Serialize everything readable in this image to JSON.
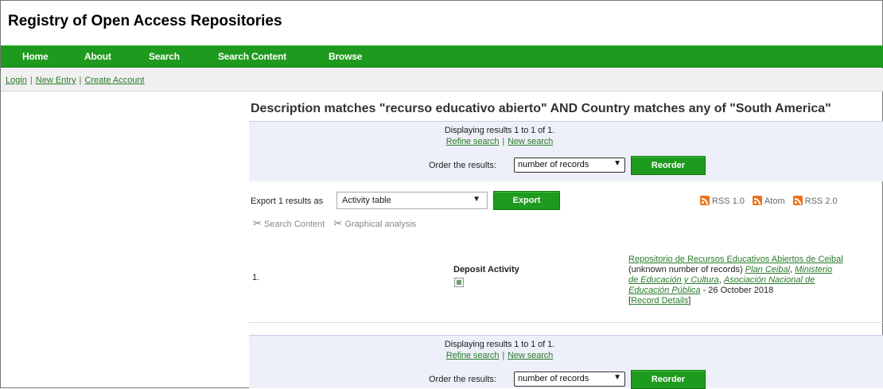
{
  "site": {
    "title": "Registry of Open Access Repositories"
  },
  "nav": {
    "items": [
      {
        "label": "Home"
      },
      {
        "label": "About"
      },
      {
        "label": "Search"
      },
      {
        "label": "Search Content"
      },
      {
        "label": "Browse"
      }
    ]
  },
  "userbar": {
    "login": "Login",
    "new_entry": "New Entry",
    "create_account": "Create Account",
    "separator": "|"
  },
  "results": {
    "heading": "Description matches \"recurso educativo abierto\" AND Country matches any of \"South America\"",
    "displaying_top": "Displaying results 1 to 1 of 1.",
    "displaying_bottom": "Displaying results 1 to 1 of 1.",
    "refine": "Refine search",
    "new_search": "New search",
    "link_separator": "|",
    "order_label": "Order the results:",
    "order_value": "number of records",
    "reorder_button": "Reorder"
  },
  "export": {
    "label": "Export 1 results as",
    "format_value": "Activity table",
    "button": "Export"
  },
  "feeds": [
    {
      "label": "RSS 1.0"
    },
    {
      "label": "Atom"
    },
    {
      "label": "RSS 2.0"
    }
  ],
  "tools": [
    {
      "label": "Search Content",
      "icon": "tools-icon"
    },
    {
      "label": "Graphical analysis",
      "icon": "tools-icon"
    }
  ],
  "result_row": {
    "number": "1.",
    "activity_label": "Deposit Activity",
    "repo_name": "Repositorio de Recursos Educativos Abiertos de Ceibal",
    "record_count": "(unknown number of records)",
    "org1": "Plan Ceibal",
    "org2": "Ministerio de Educación y Cultura",
    "org3": "Asociación Nacional de Educación Pública",
    "date": "- 26 October 2018",
    "details": "Record Details",
    "comma": ", ",
    "space": " ",
    "bracket_open": "[",
    "bracket_close": "]"
  }
}
